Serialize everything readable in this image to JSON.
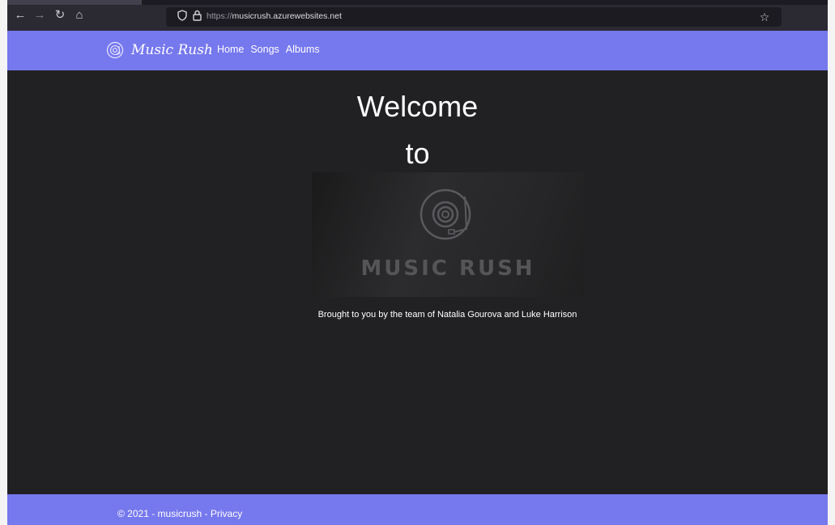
{
  "browser": {
    "url_protocol": "https://",
    "url_host": "musicrush.azurewebsites.net",
    "icons": {
      "back": "←",
      "forward": "→",
      "reload": "↻",
      "home": "⌂",
      "shield": "shield-icon",
      "lock": "lock-icon",
      "bookmark": "☆"
    }
  },
  "navbar": {
    "brand": "Music Rush",
    "links": [
      "Home",
      "Songs",
      "Albums"
    ],
    "bg_color": "#7678ed"
  },
  "main": {
    "welcome_line1": "Welcome",
    "welcome_line2": "to",
    "banner_title": "MUSIC RUSH",
    "credit": "Brought to you by the team of Natalia Gourova and Luke Harrison",
    "bg_color": "#212124"
  },
  "footer": {
    "copyright": "© 2021 - musicrush - ",
    "privacy_link": "Privacy"
  }
}
